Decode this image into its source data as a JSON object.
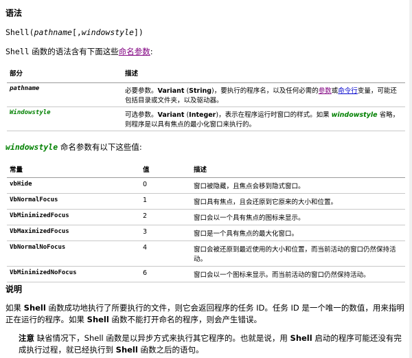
{
  "syntax_heading": "语法",
  "syntax": {
    "fn": "Shell(",
    "arg1": "pathname",
    "mid": "[,",
    "arg2": "windowstyle",
    "end": "])"
  },
  "intro": {
    "pre": "函数的语法含有下面这些",
    "fn": "Shell",
    "link": "命名参数",
    "post": ":"
  },
  "params_table": {
    "headers": [
      "部分",
      "描述"
    ],
    "rows": [
      {
        "name": "pathname",
        "desc_parts": {
          "a": "必要参数。",
          "b": "Variant",
          "c": " (",
          "d": "String",
          "e": ")，要执行的程序名，以及任何必需的",
          "link1": "参数",
          "f": "或",
          "link2": "命令行",
          "g": "变量，可能还包括目录或文件夹，以及驱动器。"
        }
      },
      {
        "name": "Windowstyle",
        "desc_parts": {
          "a": "可选参数。",
          "b": "Variant",
          "c": " (",
          "d": "Integer",
          "e": ")，表示在程序运行时窗口的样式。如果 ",
          "ws": "windowstyle",
          "f": " 省略，则程序是以具有焦点的最小化窗口来执行的。"
        }
      }
    ]
  },
  "values_intro": {
    "name": "windowstyle",
    "text": " 命名参数有以下这些值:"
  },
  "consts_table": {
    "headers": [
      "常量",
      "值",
      "描述"
    ],
    "rows": [
      {
        "c": "vbHide",
        "v": "0",
        "d": "窗口被隐藏，且焦点会移到隐式窗口。"
      },
      {
        "c": "VbNormalFocus",
        "v": "1",
        "d": "窗口具有焦点，且会还原到它原来的大小和位置。"
      },
      {
        "c": "VbMinimizedFocus",
        "v": "2",
        "d": "窗口会以一个具有焦点的图标来显示。"
      },
      {
        "c": "VbMaximizedFocus",
        "v": "3",
        "d": "窗口是一个具有焦点的最大化窗口。"
      },
      {
        "c": "VbNormalNoFocus",
        "v": "4",
        "d": "窗口会被还原到最近使用的大小和位置，而当前活动的窗口仍然保持活动。"
      },
      {
        "c": "VbMinimizedNoFocus",
        "v": "6",
        "d": "窗口会以一个图标来显示。而当前活动的窗口仍然保持活动。"
      }
    ]
  },
  "remarks_heading": "说明",
  "remarks": {
    "a": "如果 ",
    "b": "Shell",
    "c": " 函数成功地执行了所要执行的文件，则它会返回程序的任务 ID。任务 ID 是一个唯一的数值，用来指明正在运行的程序。如果 ",
    "d": "Shell",
    "e": " 函数不能打开命名的程序，则会产生错误。"
  },
  "note": {
    "label": "注意",
    "a": " 缺省情况下，Shell 函数是以异步方式来执行其它程序的。也就是说，用 ",
    "b": "Shell",
    "c": " 启动的程序可能还没有完成执行过程，就已经执行到 ",
    "d": "Shell",
    "e": " 函数之后的语句。"
  }
}
